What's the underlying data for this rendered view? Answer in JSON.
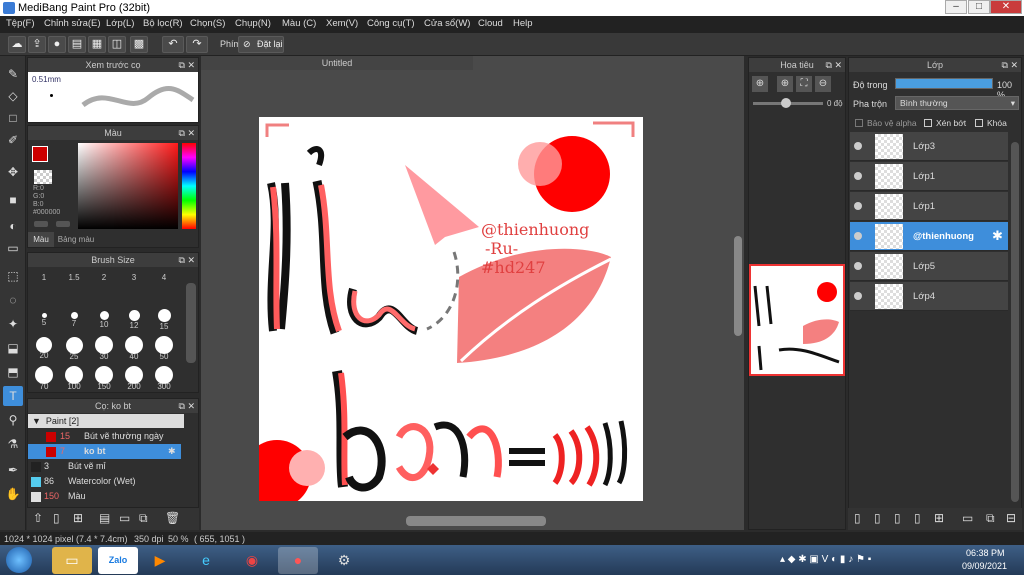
{
  "window": {
    "title": "MediBang Paint Pro (32bit)",
    "min": "–",
    "max": "□",
    "close": "✕"
  },
  "menu": [
    "Tệp(F)",
    "Chỉnh sửa(E)",
    "Lớp(L)",
    "Bộ lọc(R)",
    "Chọn(S)",
    "Chụp(N)",
    "Màu (C)",
    "Xem(V)",
    "Công cụ(T)",
    "Cửa sổ(W)",
    "Cloud",
    "Help"
  ],
  "toolbar": {
    "icons": [
      "cloud-icon",
      "share-icon",
      "chat-icon",
      "comment-icon",
      "doc-icon",
      "layout-icon",
      "grid-icon",
      "undo-icon",
      "redo-icon"
    ],
    "shortcut_label": "Phím",
    "reset_label": "Đặt lại"
  },
  "brushPreview": {
    "title": "Xem trước cọ",
    "size": "0.51mm"
  },
  "color": {
    "title": "Màu",
    "r": "R:0",
    "g": "G:0",
    "b": "B:0",
    "hex": "#000000",
    "tab1": "Màu",
    "tab2": "Bảng màu",
    "primary": "#cc0000"
  },
  "brushSize": {
    "title": "Brush Size",
    "sizes": [
      "1",
      "1.5",
      "2",
      "3",
      "4",
      "5",
      "7",
      "10",
      "12",
      "15",
      "20",
      "25",
      "30",
      "40",
      "50",
      "70",
      "100",
      "150",
      "200",
      "300"
    ]
  },
  "brushPanel": {
    "title": "Cọ: ko bt",
    "group": "Paint [2]",
    "items": [
      {
        "size": "15",
        "name": "Bút vẽ thường ngày",
        "color": "#cc0000"
      },
      {
        "size": "7",
        "name": "ko bt",
        "color": "#cc0000",
        "selected": true
      },
      {
        "size": "3",
        "name": "Bút vẽ mỉ",
        "color": "#222222"
      },
      {
        "size": "86",
        "name": "Watercolor (Wet)",
        "color": "#55ccee"
      },
      {
        "size": "150",
        "name": "Màu",
        "color": "#e0e0e0"
      }
    ]
  },
  "canvas": {
    "tab": "Untitled",
    "text_handle": "@thienhuong\n-Ru-\n#hd247"
  },
  "navigator": {
    "title": "Hoa tiêu",
    "angle": "0 độ"
  },
  "layers": {
    "title": "Lớp",
    "opacity_label": "Độ trong",
    "opacity_value": "100 %",
    "blend_label": "Pha trộn",
    "blend_value": "Bình thường",
    "protect_alpha": "Bảo vệ alpha",
    "clip": "Xén bớt",
    "lock": "Khóa",
    "items": [
      {
        "name": "Lớp3"
      },
      {
        "name": "Lớp1"
      },
      {
        "name": "Lớp1"
      },
      {
        "name": "@thienhuong",
        "selected": true
      },
      {
        "name": "Lớp5"
      },
      {
        "name": "Lớp4"
      }
    ]
  },
  "status": {
    "size": "1024 * 1024 pixel",
    "cm": "(7.4 * 7.4cm)",
    "dpi": "350 dpi",
    "zoom": "50 %",
    "coord": "( 655, 1051 )"
  },
  "taskbar": {
    "time": "06:38 PM",
    "date": "09/09/2021",
    "zalo": "Zalo"
  }
}
